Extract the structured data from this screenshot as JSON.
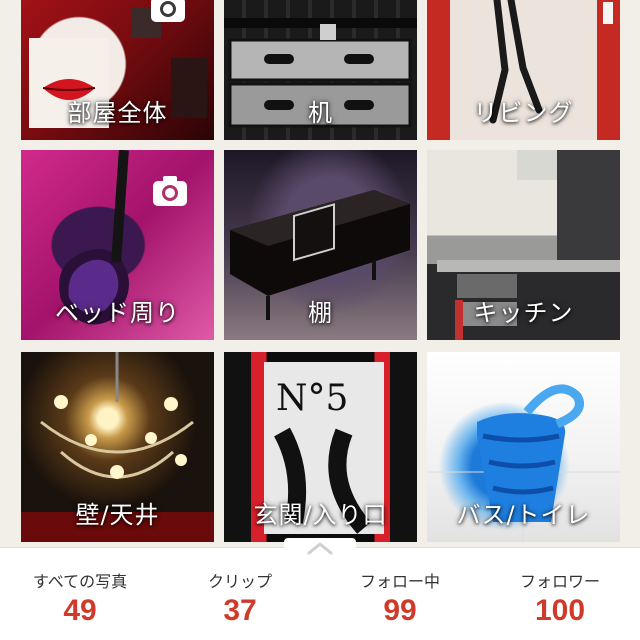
{
  "categories": [
    {
      "label": "部屋全体"
    },
    {
      "label": "机"
    },
    {
      "label": "リビング"
    },
    {
      "label": "ベッド周り"
    },
    {
      "label": "棚"
    },
    {
      "label": "キッチン"
    },
    {
      "label": "壁/天井"
    },
    {
      "label": "玄関/入り口"
    },
    {
      "label": "バス/トイレ"
    }
  ],
  "camera_icon": "camera-icon",
  "stats": [
    {
      "label": "すべての写真",
      "value": "49"
    },
    {
      "label": "クリップ",
      "value": "37"
    },
    {
      "label": "フォロー中",
      "value": "99"
    },
    {
      "label": "フォロワー",
      "value": "100"
    }
  ],
  "colors": {
    "accent_number": "#cf3a2a",
    "background": "#f2efe9"
  }
}
